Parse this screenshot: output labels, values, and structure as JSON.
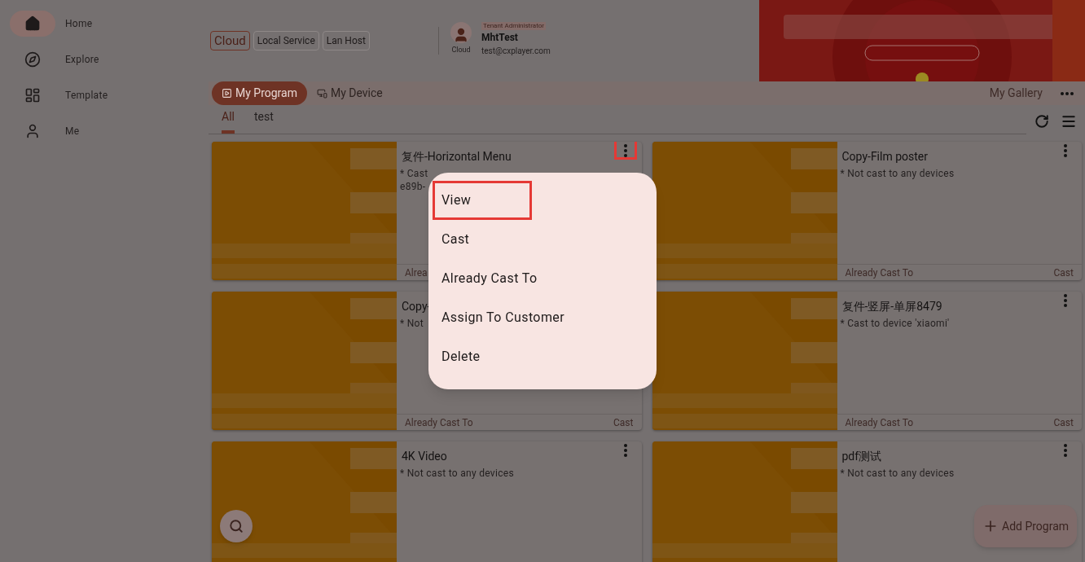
{
  "sidebar": {
    "items": [
      {
        "label": "Home",
        "selected": true
      },
      {
        "label": "Explore",
        "selected": false
      },
      {
        "label": "Template",
        "selected": false
      },
      {
        "label": "Me",
        "selected": false
      }
    ]
  },
  "header": {
    "sources": [
      {
        "label": "Cloud",
        "selected": true
      },
      {
        "label": "Local Service",
        "selected": false
      },
      {
        "label": "Lan Host",
        "selected": false
      }
    ],
    "account": {
      "avatar_caption": "Cloud",
      "role": "Tenant Administrator",
      "name": "MhtTest",
      "email": "test@cxplayer.com"
    }
  },
  "main_tabs": {
    "tabs": [
      {
        "label": "My Program",
        "selected": true
      },
      {
        "label": "My Device",
        "selected": false
      }
    ],
    "gallery": "My Gallery"
  },
  "categories": [
    {
      "label": "All",
      "selected": true
    },
    {
      "label": "test",
      "selected": false
    }
  ],
  "programs": [
    {
      "title": "复件-Horizontal Menu",
      "status": [
        "* Cast",
        "e89b-"
      ],
      "already_cast": "Alrea",
      "highlighted": true
    },
    {
      "title": "Copy-Film poster",
      "status": [
        "* Not cast to any devices"
      ],
      "already_cast": "Already Cast To",
      "cast": "Cast",
      "highlighted": false
    },
    {
      "title": "Copy-",
      "status": [
        "* Not"
      ],
      "already_cast": "Already Cast To",
      "cast": "Cast"
    },
    {
      "title": "复件-竖屏-单屏8479",
      "status": [
        "* Cast to device 'xiaomi'"
      ],
      "already_cast": "Already Cast To",
      "cast": "Cast",
      "highlighted": false
    },
    {
      "title": "4K Video",
      "status": [
        "* Not cast to any devices"
      ],
      "highlighted": false
    },
    {
      "title": "pdf测试",
      "status": [
        "* Not cast to any devices"
      ],
      "highlighted": false
    }
  ],
  "context_menu": {
    "items": [
      {
        "label": "View",
        "highlighted": true
      },
      {
        "label": "Cast",
        "highlighted": false
      },
      {
        "label": "Already Cast To",
        "highlighted": false
      },
      {
        "label": "Assign To Customer",
        "highlighted": false
      },
      {
        "label": "Delete",
        "highlighted": false
      }
    ]
  },
  "add_button": "Add Program"
}
